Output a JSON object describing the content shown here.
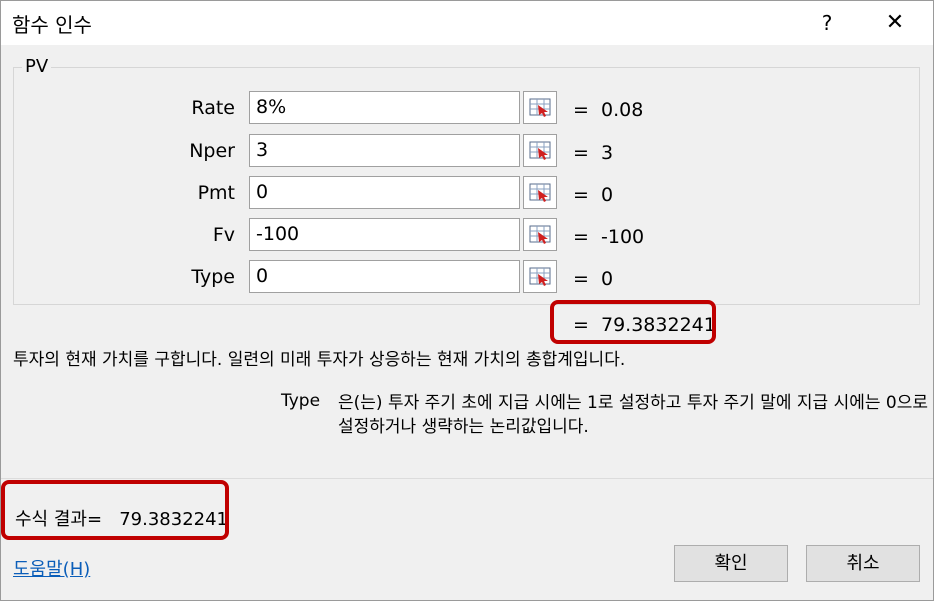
{
  "window": {
    "title": "함수 인수",
    "help_label": "?",
    "close_label": "✕"
  },
  "function_name": "PV",
  "arguments": [
    {
      "name": "Rate",
      "value": "8%",
      "result": "=  0.08"
    },
    {
      "name": "Nper",
      "value": "3",
      "result": "=  3"
    },
    {
      "name": "Pmt",
      "value": "0",
      "result": "=  0"
    },
    {
      "name": "Fv",
      "value": "-100",
      "result": "=  -100"
    },
    {
      "name": "Type",
      "value": "0",
      "result": "=  0"
    }
  ],
  "overall_result": "=  79.3832241",
  "description": "투자의 현재 가치를 구합니다. 일련의 미래 투자가 상응하는 현재 가치의 총합계입니다.",
  "arg_description": {
    "name": "Type",
    "text": "은(는) 투자 주기 초에 지급 시에는 1로 설정하고 투자 주기 말에 지급 시에는 0으로 설정하거나 생략하는 논리값입니다."
  },
  "formula_result": {
    "label": "수식 결과=",
    "value": "79.3832241"
  },
  "help_link": "도움말(H)",
  "buttons": {
    "ok": "확인",
    "cancel": "취소"
  },
  "highlight_color": "#c00000"
}
